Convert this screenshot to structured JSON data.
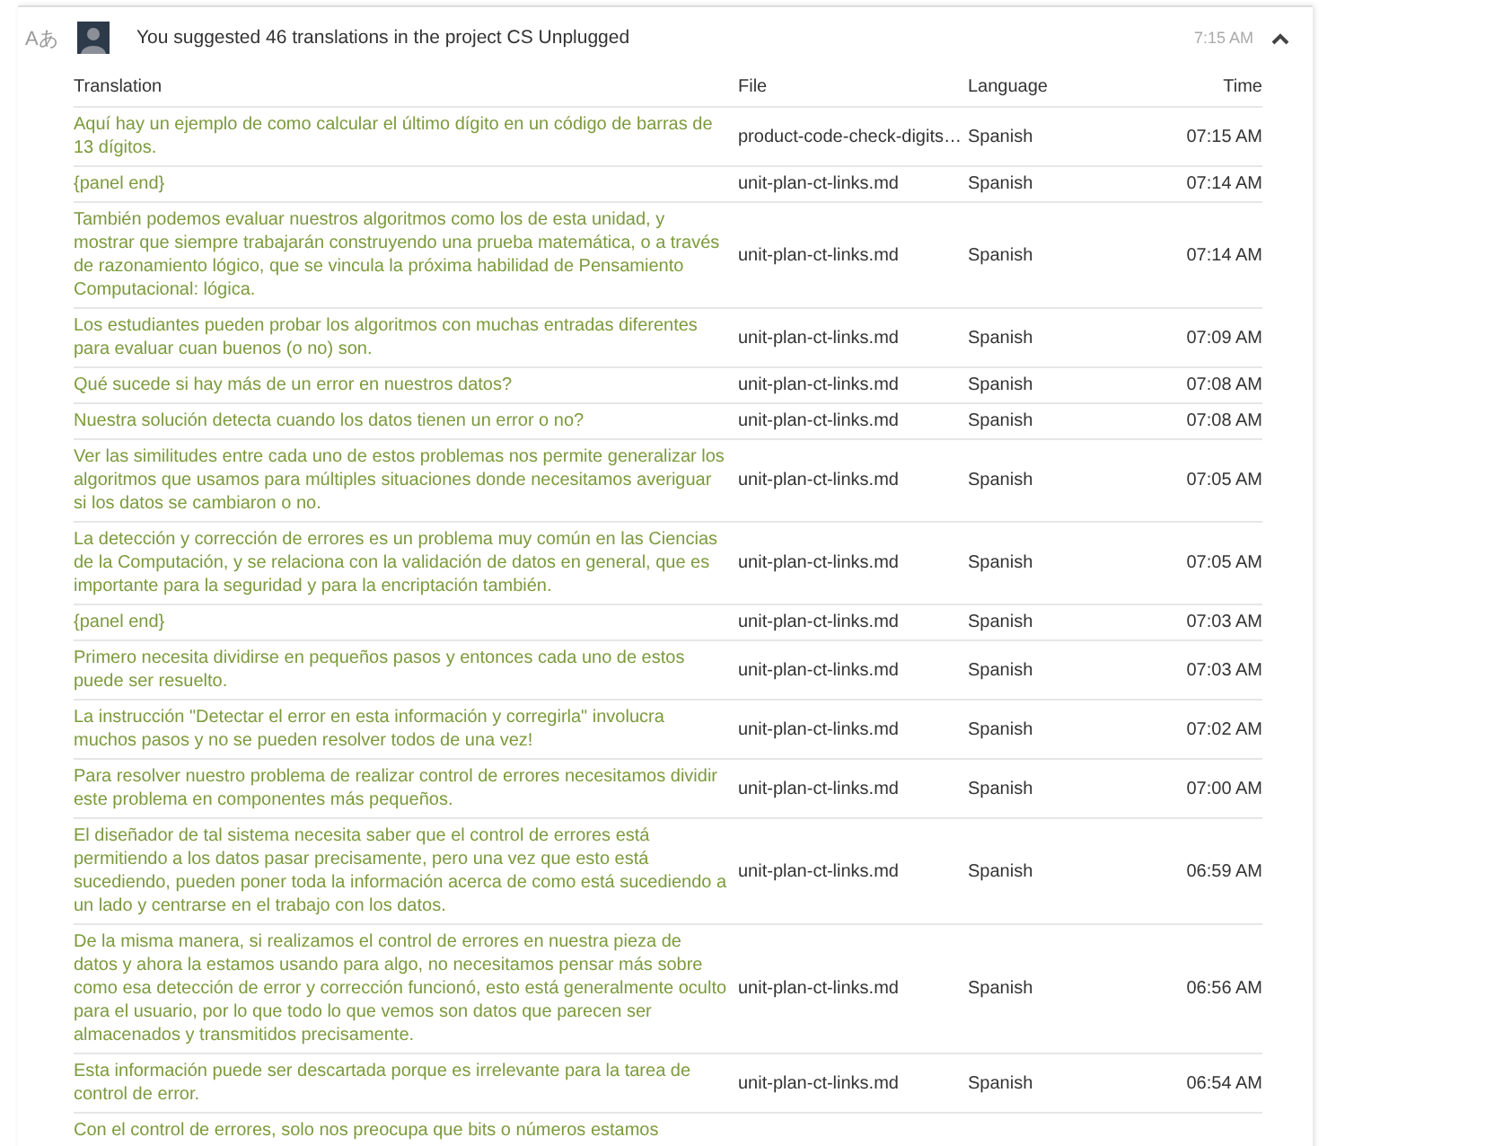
{
  "activity": {
    "type_glyph": "Aあ",
    "summary": "You suggested 46 translations in the project",
    "project": "CS Unplugged",
    "time": "7:15 AM",
    "expanded": true
  },
  "table": {
    "columns": [
      "Translation",
      "File",
      "Language",
      "Time"
    ],
    "rows": [
      {
        "translation": "Aquí hay un ejemplo de como calcular el último dígito en un código de barras de 13 dígitos.",
        "file": "product-code-check-digits…",
        "language": "Spanish",
        "time": "07:15 AM"
      },
      {
        "translation": "{panel end}",
        "file": "unit-plan-ct-links.md",
        "language": "Spanish",
        "time": "07:14 AM"
      },
      {
        "translation": "También podemos evaluar nuestros algoritmos como los de esta unidad, y mostrar que siempre trabajarán construyendo una prueba matemática, o a través de razonamiento lógico, que se vincula la próxima habilidad de Pensamiento Computacional: lógica.",
        "file": "unit-plan-ct-links.md",
        "language": "Spanish",
        "time": "07:14 AM"
      },
      {
        "translation": "Los estudiantes pueden probar los algoritmos con muchas entradas diferentes para evaluar cuan buenos (o no) son.",
        "file": "unit-plan-ct-links.md",
        "language": "Spanish",
        "time": "07:09 AM"
      },
      {
        "translation": "Qué sucede si hay más de un error en nuestros datos?",
        "file": "unit-plan-ct-links.md",
        "language": "Spanish",
        "time": "07:08 AM"
      },
      {
        "translation": "Nuestra solución detecta cuando los datos tienen un error o no?",
        "file": "unit-plan-ct-links.md",
        "language": "Spanish",
        "time": "07:08 AM"
      },
      {
        "translation": "Ver las similitudes entre cada uno de estos problemas nos permite generalizar los algoritmos que usamos para múltiples situaciones donde necesitamos averiguar si los datos se cambiaron o no.",
        "file": "unit-plan-ct-links.md",
        "language": "Spanish",
        "time": "07:05 AM"
      },
      {
        "translation": "La detección y corrección de errores es un problema muy común en las Ciencias de la Computación, y se relaciona con la validación de datos en general, que es importante para la seguridad y para la encriptación también.",
        "file": "unit-plan-ct-links.md",
        "language": "Spanish",
        "time": "07:05 AM"
      },
      {
        "translation": "{panel end}",
        "file": "unit-plan-ct-links.md",
        "language": "Spanish",
        "time": "07:03 AM"
      },
      {
        "translation": "Primero necesita dividirse en pequeños pasos y entonces cada uno de estos puede ser resuelto.",
        "file": "unit-plan-ct-links.md",
        "language": "Spanish",
        "time": "07:03 AM"
      },
      {
        "translation": "La instrucción \"Detectar el error en esta información y corregirla\" involucra muchos pasos y no se pueden resolver todos de una vez!",
        "file": "unit-plan-ct-links.md",
        "language": "Spanish",
        "time": "07:02 AM"
      },
      {
        "translation": "Para resolver nuestro problema de realizar control de errores necesitamos dividir este problema en componentes más pequeños.",
        "file": "unit-plan-ct-links.md",
        "language": "Spanish",
        "time": "07:00 AM"
      },
      {
        "translation": "El diseñador de tal sistema necesita saber que el control de errores está permitiendo a los datos pasar precisamente, pero una vez que esto está sucediendo, pueden poner toda la información acerca de como está sucediendo a un lado y centrarse en el trabajo con los datos.",
        "file": "unit-plan-ct-links.md",
        "language": "Spanish",
        "time": "06:59 AM"
      },
      {
        "translation": "De la misma manera, si realizamos el control de errores en nuestra pieza de datos y ahora la estamos usando para algo, no necesitamos pensar más sobre como esa detección de error y corrección funcionó, esto está generalmente oculto para el usuario, por lo que todo lo que vemos son datos que parecen ser almacenados y transmitidos precisamente.",
        "file": "unit-plan-ct-links.md",
        "language": "Spanish",
        "time": "06:56 AM"
      },
      {
        "translation": "Esta información puede ser descartada porque es irrelevante para la tarea de control de error.",
        "file": "unit-plan-ct-links.md",
        "language": "Spanish",
        "time": "06:54 AM"
      },
      {
        "translation": "Con el control de errores, solo nos preocupa que bits o números estamos"
      }
    ]
  }
}
